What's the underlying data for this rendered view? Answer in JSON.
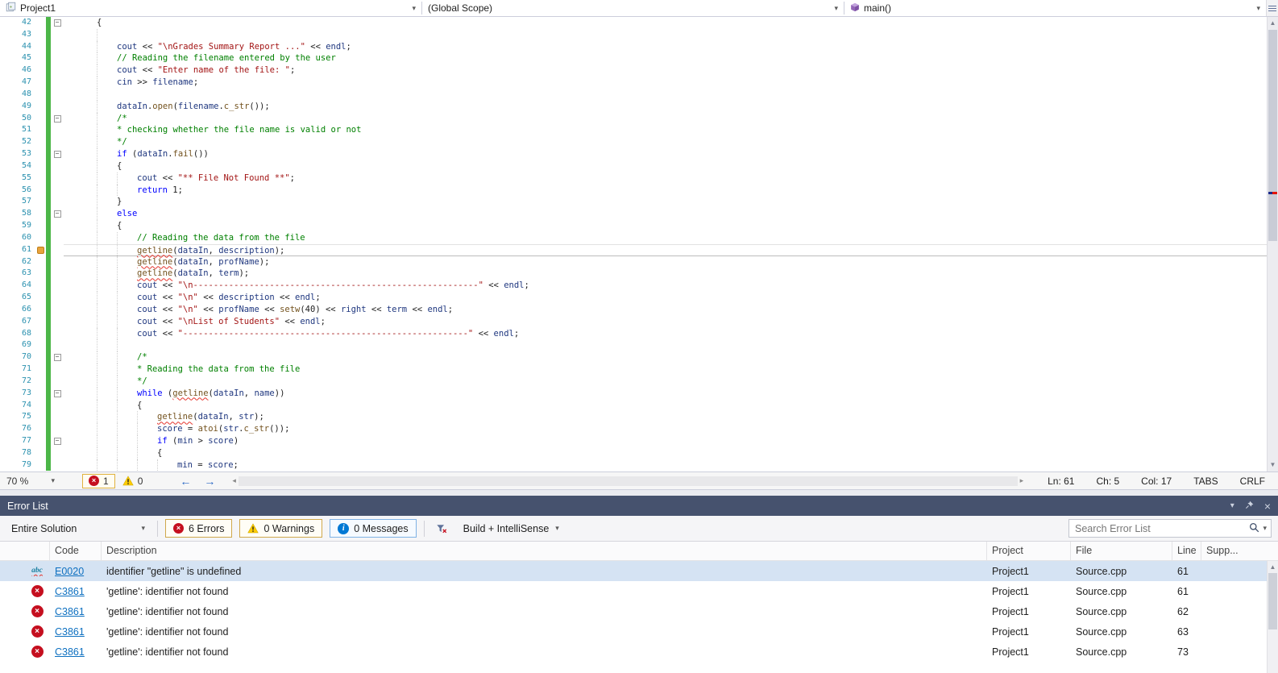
{
  "colors": {
    "error-red": "#c50f1f",
    "warning-yellow": "#ffcc00",
    "info-blue": "#0078d4",
    "change-green": "#4cb648",
    "line-number": "#2b91af",
    "keyword-blue": "#0000ff",
    "string-red": "#a31515",
    "comment-green": "#008000",
    "function-brown": "#74531f",
    "identifier-navy": "#1f377f",
    "link-blue": "#0e70c0",
    "panel-title-bg": "#46526e",
    "selected-row-blue": "#d5e3f3"
  },
  "topnav": {
    "project": "Project1",
    "scope": "(Global Scope)",
    "member": "main()"
  },
  "editor": {
    "status": {
      "zoom": "70 %",
      "errors": "1",
      "warnings": "0",
      "ln": "Ln: 61",
      "ch": "Ch: 5",
      "col": "Col: 17",
      "tabs": "TABS",
      "eol": "CRLF"
    },
    "lines": [
      {
        "n": 42,
        "ind": 1,
        "out": true,
        "segs": [
          [
            "p",
            "{"
          ]
        ]
      },
      {
        "n": 43,
        "ind": 2,
        "segs": []
      },
      {
        "n": 44,
        "ind": 2,
        "segs": [
          [
            "v",
            "cout"
          ],
          [
            "p",
            " << "
          ],
          [
            "s",
            "\"\\nGrades Summary Report ...\""
          ],
          [
            "p",
            " << "
          ],
          [
            "v",
            "endl"
          ],
          [
            "p",
            ";"
          ]
        ]
      },
      {
        "n": 45,
        "ind": 2,
        "segs": [
          [
            "c",
            "// Reading the filename entered by the user"
          ]
        ]
      },
      {
        "n": 46,
        "ind": 2,
        "segs": [
          [
            "v",
            "cout"
          ],
          [
            "p",
            " << "
          ],
          [
            "s",
            "\"Enter name of the file: \""
          ],
          [
            "p",
            ";"
          ]
        ]
      },
      {
        "n": 47,
        "ind": 2,
        "segs": [
          [
            "v",
            "cin"
          ],
          [
            "p",
            " >> "
          ],
          [
            "v",
            "filename"
          ],
          [
            "p",
            ";"
          ]
        ]
      },
      {
        "n": 48,
        "ind": 2,
        "segs": []
      },
      {
        "n": 49,
        "ind": 2,
        "segs": [
          [
            "v",
            "dataIn"
          ],
          [
            "p",
            "."
          ],
          [
            "f",
            "open"
          ],
          [
            "p",
            "("
          ],
          [
            "v",
            "filename"
          ],
          [
            "p",
            "."
          ],
          [
            "f",
            "c_str"
          ],
          [
            "p",
            "());"
          ]
        ]
      },
      {
        "n": 50,
        "ind": 2,
        "out": true,
        "segs": [
          [
            "c",
            "/*"
          ]
        ]
      },
      {
        "n": 51,
        "ind": 2,
        "segs": [
          [
            "c",
            "* checking whether the file name is valid or not"
          ]
        ]
      },
      {
        "n": 52,
        "ind": 2,
        "segs": [
          [
            "c",
            "*/"
          ]
        ]
      },
      {
        "n": 53,
        "ind": 2,
        "out": true,
        "segs": [
          [
            "k",
            "if"
          ],
          [
            "p",
            " ("
          ],
          [
            "v",
            "dataIn"
          ],
          [
            "p",
            "."
          ],
          [
            "f",
            "fail"
          ],
          [
            "p",
            "())"
          ]
        ]
      },
      {
        "n": 54,
        "ind": 2,
        "segs": [
          [
            "p",
            "{"
          ]
        ]
      },
      {
        "n": 55,
        "ind": 3,
        "segs": [
          [
            "v",
            "cout"
          ],
          [
            "p",
            " << "
          ],
          [
            "s",
            "\"** File Not Found **\""
          ],
          [
            "p",
            ";"
          ]
        ]
      },
      {
        "n": 56,
        "ind": 3,
        "segs": [
          [
            "k",
            "return"
          ],
          [
            "p",
            " 1;"
          ]
        ]
      },
      {
        "n": 57,
        "ind": 2,
        "segs": [
          [
            "p",
            "}"
          ]
        ]
      },
      {
        "n": 58,
        "ind": 2,
        "out": true,
        "segs": [
          [
            "k",
            "else"
          ]
        ]
      },
      {
        "n": 59,
        "ind": 2,
        "segs": [
          [
            "p",
            "{"
          ]
        ]
      },
      {
        "n": 60,
        "ind": 3,
        "segs": [
          [
            "c",
            "// Reading the data from the file"
          ]
        ]
      },
      {
        "n": 61,
        "ind": 3,
        "cur": true,
        "glyph": true,
        "segs": [
          [
            "fq",
            "getline"
          ],
          [
            "p",
            "("
          ],
          [
            "v",
            "dataIn"
          ],
          [
            "p",
            ", "
          ],
          [
            "v",
            "description"
          ],
          [
            "p",
            ");"
          ]
        ]
      },
      {
        "n": 62,
        "ind": 3,
        "segs": [
          [
            "fq",
            "getline"
          ],
          [
            "p",
            "("
          ],
          [
            "v",
            "dataIn"
          ],
          [
            "p",
            ", "
          ],
          [
            "v",
            "profName"
          ],
          [
            "p",
            ");"
          ]
        ]
      },
      {
        "n": 63,
        "ind": 3,
        "segs": [
          [
            "fq",
            "getline"
          ],
          [
            "p",
            "("
          ],
          [
            "v",
            "dataIn"
          ],
          [
            "p",
            ", "
          ],
          [
            "v",
            "term"
          ],
          [
            "p",
            ");"
          ]
        ]
      },
      {
        "n": 64,
        "ind": 3,
        "segs": [
          [
            "v",
            "cout"
          ],
          [
            "p",
            " << "
          ],
          [
            "s",
            "\"\\n--------------------------------------------------------\""
          ],
          [
            "p",
            " << "
          ],
          [
            "v",
            "endl"
          ],
          [
            "p",
            ";"
          ]
        ]
      },
      {
        "n": 65,
        "ind": 3,
        "segs": [
          [
            "v",
            "cout"
          ],
          [
            "p",
            " << "
          ],
          [
            "s",
            "\"\\n\""
          ],
          [
            "p",
            " << "
          ],
          [
            "v",
            "description"
          ],
          [
            "p",
            " << "
          ],
          [
            "v",
            "endl"
          ],
          [
            "p",
            ";"
          ]
        ]
      },
      {
        "n": 66,
        "ind": 3,
        "segs": [
          [
            "v",
            "cout"
          ],
          [
            "p",
            " << "
          ],
          [
            "s",
            "\"\\n\""
          ],
          [
            "p",
            " << "
          ],
          [
            "v",
            "profName"
          ],
          [
            "p",
            " << "
          ],
          [
            "f",
            "setw"
          ],
          [
            "p",
            "(40) << "
          ],
          [
            "v",
            "right"
          ],
          [
            "p",
            " << "
          ],
          [
            "v",
            "term"
          ],
          [
            "p",
            " << "
          ],
          [
            "v",
            "endl"
          ],
          [
            "p",
            ";"
          ]
        ]
      },
      {
        "n": 67,
        "ind": 3,
        "segs": [
          [
            "v",
            "cout"
          ],
          [
            "p",
            " << "
          ],
          [
            "s",
            "\"\\nList of Students\""
          ],
          [
            "p",
            " << "
          ],
          [
            "v",
            "endl"
          ],
          [
            "p",
            ";"
          ]
        ]
      },
      {
        "n": 68,
        "ind": 3,
        "segs": [
          [
            "v",
            "cout"
          ],
          [
            "p",
            " << "
          ],
          [
            "s",
            "\"--------------------------------------------------------\""
          ],
          [
            "p",
            " << "
          ],
          [
            "v",
            "endl"
          ],
          [
            "p",
            ";"
          ]
        ]
      },
      {
        "n": 69,
        "ind": 3,
        "segs": []
      },
      {
        "n": 70,
        "ind": 3,
        "out": true,
        "segs": [
          [
            "c",
            "/*"
          ]
        ]
      },
      {
        "n": 71,
        "ind": 3,
        "segs": [
          [
            "c",
            "* Reading the data from the file"
          ]
        ]
      },
      {
        "n": 72,
        "ind": 3,
        "segs": [
          [
            "c",
            "*/"
          ]
        ]
      },
      {
        "n": 73,
        "ind": 3,
        "out": true,
        "segs": [
          [
            "k",
            "while"
          ],
          [
            "p",
            " ("
          ],
          [
            "fq",
            "getline"
          ],
          [
            "p",
            "("
          ],
          [
            "v",
            "dataIn"
          ],
          [
            "p",
            ", "
          ],
          [
            "v",
            "name"
          ],
          [
            "p",
            "))"
          ]
        ]
      },
      {
        "n": 74,
        "ind": 3,
        "segs": [
          [
            "p",
            "{"
          ]
        ]
      },
      {
        "n": 75,
        "ind": 4,
        "segs": [
          [
            "fq",
            "getline"
          ],
          [
            "p",
            "("
          ],
          [
            "v",
            "dataIn"
          ],
          [
            "p",
            ", "
          ],
          [
            "v",
            "str"
          ],
          [
            "p",
            ");"
          ]
        ]
      },
      {
        "n": 76,
        "ind": 4,
        "segs": [
          [
            "v",
            "score"
          ],
          [
            "p",
            " = "
          ],
          [
            "f",
            "atoi"
          ],
          [
            "p",
            "("
          ],
          [
            "v",
            "str"
          ],
          [
            "p",
            "."
          ],
          [
            "f",
            "c_str"
          ],
          [
            "p",
            "());"
          ]
        ]
      },
      {
        "n": 77,
        "ind": 4,
        "out": true,
        "segs": [
          [
            "k",
            "if"
          ],
          [
            "p",
            " ("
          ],
          [
            "v",
            "min"
          ],
          [
            "p",
            " > "
          ],
          [
            "v",
            "score"
          ],
          [
            "p",
            ")"
          ]
        ]
      },
      {
        "n": 78,
        "ind": 4,
        "segs": [
          [
            "p",
            "{"
          ]
        ]
      },
      {
        "n": 79,
        "ind": 5,
        "segs": [
          [
            "v",
            "min"
          ],
          [
            "p",
            " = "
          ],
          [
            "v",
            "score"
          ],
          [
            "p",
            ";"
          ]
        ]
      }
    ]
  },
  "error_list": {
    "title": "Error List",
    "toolbar": {
      "scope": "Entire Solution",
      "errors": "6 Errors",
      "warnings": "0 Warnings",
      "messages": "0 Messages",
      "source": "Build + IntelliSense",
      "search_placeholder": "Search Error List"
    },
    "columns": [
      "Code",
      "Description",
      "Project",
      "File",
      "Line",
      "Supp..."
    ],
    "rows": [
      {
        "icon": "intellisense",
        "code": "E0020",
        "description": "identifier \"getline\" is undefined",
        "project": "Project1",
        "file": "Source.cpp",
        "line": "61",
        "selected": true
      },
      {
        "icon": "error",
        "code": "C3861",
        "description": "'getline': identifier not found",
        "project": "Project1",
        "file": "Source.cpp",
        "line": "61"
      },
      {
        "icon": "error",
        "code": "C3861",
        "description": "'getline': identifier not found",
        "project": "Project1",
        "file": "Source.cpp",
        "line": "62"
      },
      {
        "icon": "error",
        "code": "C3861",
        "description": "'getline': identifier not found",
        "project": "Project1",
        "file": "Source.cpp",
        "line": "63"
      },
      {
        "icon": "error",
        "code": "C3861",
        "description": "'getline': identifier not found",
        "project": "Project1",
        "file": "Source.cpp",
        "line": "73"
      }
    ]
  }
}
